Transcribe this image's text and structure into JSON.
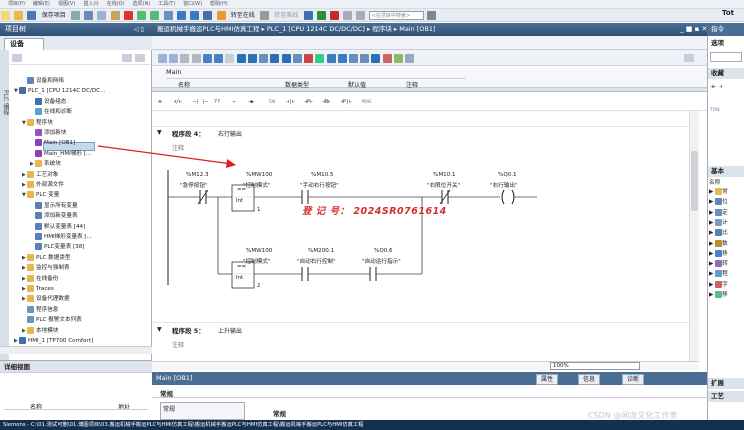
{
  "menubar": {
    "items": [
      "项目(P)",
      "编辑(E)",
      "视图(V)",
      "插入(I)",
      "在线(O)",
      "选项(N)",
      "工具(T)",
      "窗口(W)",
      "帮助(H)"
    ]
  },
  "toolbar": {
    "save_label": "保存项目",
    "online_label": "转至在线",
    "offline_label": "转至离线",
    "search_placeholder": "<在项目中搜索>"
  },
  "top_right_label": "Tot",
  "project_tree": {
    "title": "项目树",
    "tab": "设备",
    "items": [
      {
        "label": "设备和网络",
        "indent": 1,
        "icon": "network-icon"
      },
      {
        "label": "PLC_1 [CPU 1214C DC/DC...",
        "indent": 0,
        "icon": "plc-icon",
        "expanded": true
      },
      {
        "label": "设备组态",
        "indent": 2,
        "icon": "config-icon"
      },
      {
        "label": "在线和诊断",
        "indent": 2,
        "icon": "diagnostic-icon"
      },
      {
        "label": "程序块",
        "indent": 1,
        "icon": "folder-icon",
        "expanded": true
      },
      {
        "label": "添加新块",
        "indent": 2,
        "icon": "add-block-icon"
      },
      {
        "label": "Main [OB1]",
        "indent": 2,
        "icon": "ob-block-icon",
        "selected": true
      },
      {
        "label": "Main_HMI梯形 [...",
        "indent": 2,
        "icon": "fc-block-icon"
      },
      {
        "label": "系统块",
        "indent": 2,
        "icon": "folder-icon"
      },
      {
        "label": "工艺对象",
        "indent": 1,
        "icon": "folder-icon"
      },
      {
        "label": "外部源文件",
        "indent": 1,
        "icon": "folder-icon"
      },
      {
        "label": "PLC 变量",
        "indent": 1,
        "icon": "folder-icon",
        "expanded": true
      },
      {
        "label": "显示所有变量",
        "indent": 2,
        "icon": "tag-table-icon"
      },
      {
        "label": "添加新变量表",
        "indent": 2,
        "icon": "tag-table-icon"
      },
      {
        "label": "默认变量表 [44]",
        "indent": 2,
        "icon": "tag-table-icon"
      },
      {
        "label": "HMI梯形变量表 [...",
        "indent": 2,
        "icon": "tag-table-icon"
      },
      {
        "label": "PLC变量表 [38]",
        "indent": 2,
        "icon": "tag-table-icon"
      },
      {
        "label": "PLC 数据类型",
        "indent": 1,
        "icon": "folder-icon"
      },
      {
        "label": "监控与强制表",
        "indent": 1,
        "icon": "folder-icon"
      },
      {
        "label": "在线备份",
        "indent": 1,
        "icon": "folder-icon"
      },
      {
        "label": "Traces",
        "indent": 1,
        "icon": "folder-icon"
      },
      {
        "label": "设备代理数据",
        "indent": 1,
        "icon": "folder-icon"
      },
      {
        "label": "程序信息",
        "indent": 1,
        "icon": "info-icon"
      },
      {
        "label": "PLC 报警文本列表",
        "indent": 1,
        "icon": "list-icon"
      },
      {
        "label": "本地模块",
        "indent": 1,
        "icon": "folder-icon"
      },
      {
        "label": "HMI_1 [TP700 Comfort]",
        "indent": 0,
        "icon": "hmi-icon"
      }
    ],
    "detail_view_title": "详细视图",
    "detail_cols": [
      "名称",
      "地址"
    ]
  },
  "editor": {
    "breadcrumb": "搬运机械手搬运PLC与HMI仿真工程 ▸ PLC_1 [CPU 1214C DC/DC/DC] ▸ 程序块 ▸ Main [OB1]",
    "block_name": "Main",
    "interface_cols": [
      "名称",
      "数据类型",
      "默认值",
      "注释"
    ],
    "ladder_buttons": [
      "⊣⊢",
      "⊣/⊢",
      "─( )─",
      "??",
      "→",
      "⊣▶",
      "TON",
      "⊣|⊢",
      "⊣P⊢",
      "⊣N⊢",
      "⊣P|⊢",
      "MOVE"
    ],
    "networks": [
      {
        "title": "程序段 4：",
        "subtitle": "右行输出",
        "comment": "注释",
        "rung1": [
          {
            "addr": "%M12.3",
            "name": "\"急停按钮\"",
            "type": "nc"
          },
          {
            "addr": "%MW100",
            "name": "\"控制模式\"",
            "type": "cmp",
            "op": "==",
            "dtype": "Int",
            "value": "1"
          },
          {
            "addr": "%M10.5",
            "name": "\"手动右行按钮\"",
            "type": "no"
          },
          {
            "addr": "%M10.1",
            "name": "\"右限位开关\"",
            "type": "nc"
          },
          {
            "addr": "%Q0.1",
            "name": "\"右行输出\"",
            "type": "coil"
          }
        ],
        "rung2": [
          {
            "addr": "%MW100",
            "name": "\"控制模式\"",
            "type": "cmp",
            "op": "==",
            "dtype": "Int",
            "value": "2"
          },
          {
            "addr": "%M200.1",
            "name": "\"自动右行控制\"",
            "type": "no"
          },
          {
            "addr": "%Q0.6",
            "name": "\"自动运行指示\"",
            "type": "no"
          }
        ]
      },
      {
        "title": "程序段 5：",
        "subtitle": "上升输出",
        "comment": "注释"
      }
    ],
    "watermark": "登 记 号： 2024SR0761614",
    "zoom": "100%"
  },
  "inspector": {
    "title": "Main [OB1]",
    "tabs": [
      "属性",
      "信息",
      "诊断"
    ],
    "section": "常规",
    "left_item": "常规",
    "right_label": "常规"
  },
  "right_panel": {
    "title": "指令",
    "options": "选项",
    "favorites": "收藏",
    "basic": "基本",
    "name_col": "名称",
    "extended": "扩展",
    "tech": "工艺",
    "items": [
      "常",
      "位",
      "定",
      "计",
      "比",
      "数",
      "移",
      "转",
      "程",
      "字",
      "移"
    ]
  },
  "taskbar": {
    "text": "Siemens - C:\\01.测试可删\\01.博图项目\\03.搬运机械手搬运PLC与HMI仿真工程\\搬运机械手搬运PLC与HMI仿真工程\\搬运机械手搬运PLC与HMI仿真工程"
  },
  "csdn_watermark": "CSDN @闻龙文化工作室",
  "colors": {
    "title_blue": "#3a5f89",
    "wire_red": "#e02020",
    "seal_red": "#d42d2d",
    "tree_select": "#c8d8ec"
  }
}
